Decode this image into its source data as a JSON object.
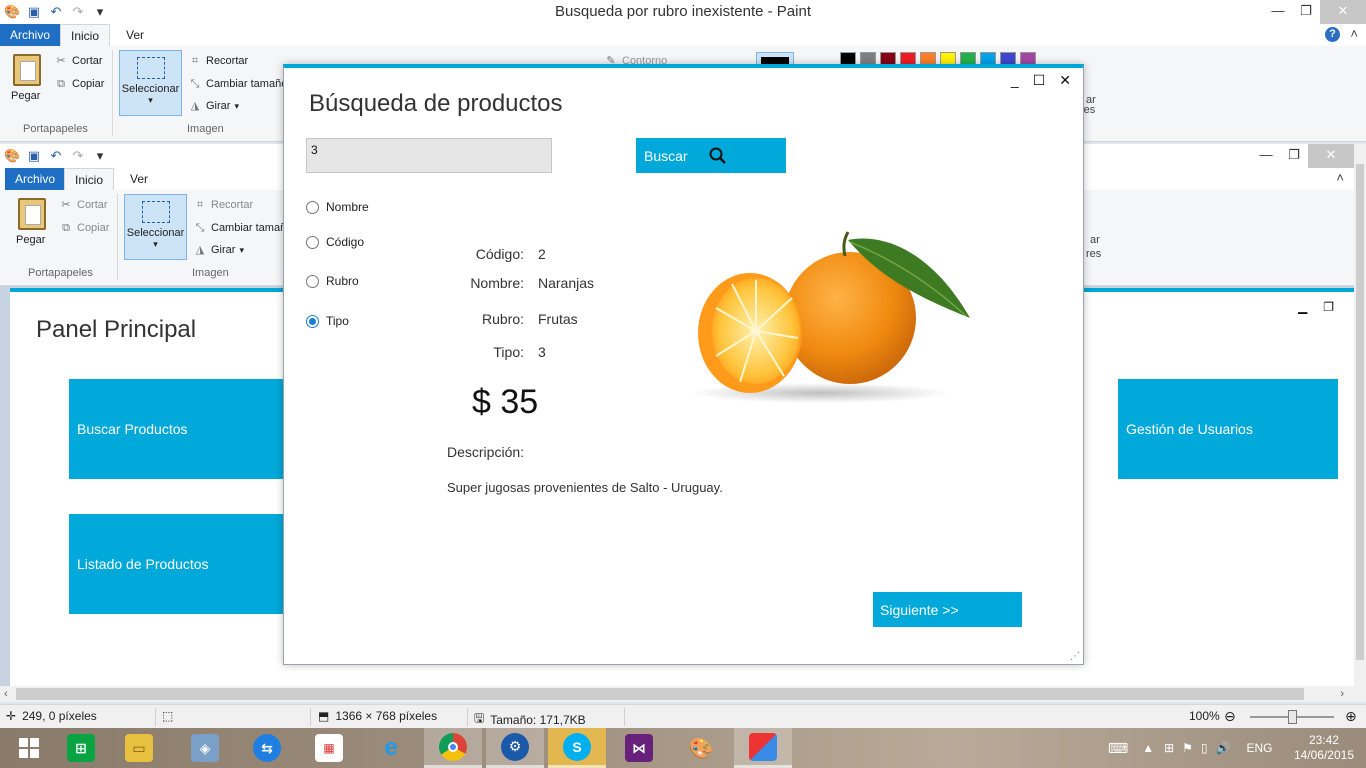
{
  "window": {
    "title": "Busqueda por rubro inexistente - Paint"
  },
  "tabs": {
    "file": "Archivo",
    "home": "Inicio",
    "view": "Ver"
  },
  "ribbon": {
    "paste": "Pegar",
    "cut": "Cortar",
    "copy": "Copiar",
    "select": "Seleccionar",
    "crop": "Recortar",
    "resize": "Cambiar tamaño",
    "rotate": "Girar",
    "outline": "Contorno",
    "clipboard_group": "Portapapeles",
    "image_group": "Imagen",
    "edit_colors_partial": "ar",
    "colors_partial": "res"
  },
  "palette": [
    "#000000",
    "#7f7f7f",
    "#880015",
    "#ed1c24",
    "#ff7f27",
    "#fff200",
    "#22b14c",
    "#00a2e8",
    "#3f48cc",
    "#a349a4"
  ],
  "panel": {
    "title": "Panel Principal",
    "tiles": [
      "Buscar Productos",
      "Listado de Productos",
      "Gestión de Usuarios"
    ]
  },
  "dialog": {
    "title": "Búsqueda de productos",
    "search_value": "3",
    "search_button": "Buscar",
    "radios": [
      {
        "label": "Nombre",
        "checked": false
      },
      {
        "label": "Código",
        "checked": false
      },
      {
        "label": "Rubro",
        "checked": false
      },
      {
        "label": "Tipo",
        "checked": true
      }
    ],
    "fields": [
      {
        "label": "Código:",
        "value": "2"
      },
      {
        "label": "Nombre:",
        "value": "Naranjas"
      },
      {
        "label": "Rubro:",
        "value": "Frutas"
      },
      {
        "label": "Tipo:",
        "value": "3"
      }
    ],
    "price": "$ 35",
    "description_label": "Descripción:",
    "description": "Super jugosas provenientes de Salto - Uruguay.",
    "next_button": "Siguiente >>"
  },
  "status": {
    "cursor": "249, 0 píxeles",
    "dimensions": "1366 × 768 píxeles",
    "size": "Tamaño: 171,7KB",
    "zoom": "100%"
  },
  "tray": {
    "language": "ENG",
    "time": "23:42",
    "date": "14/06/2015"
  }
}
